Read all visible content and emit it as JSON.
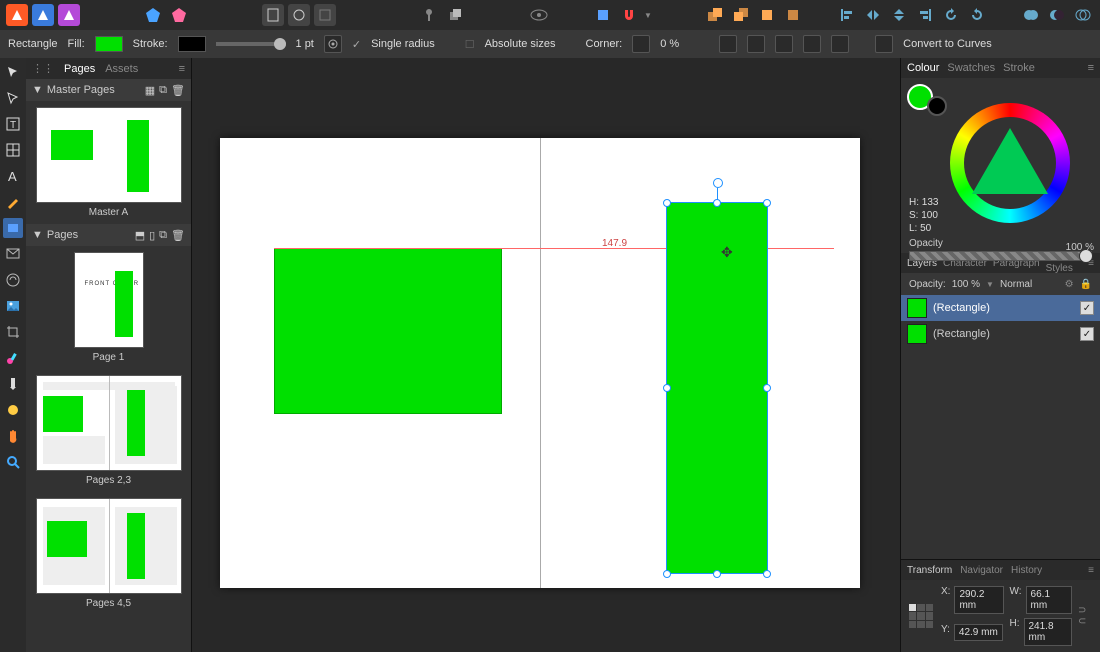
{
  "top_toolbar": {
    "app_icons": [
      "designer-app",
      "publisher-app",
      "photo-app"
    ],
    "groups": [
      [
        "persona-outline",
        "persona-pixel"
      ],
      [
        "doc-new",
        "shape-circle",
        "shape-square"
      ],
      [
        "pin",
        "layers-small"
      ],
      [
        "preview-mode"
      ],
      [
        "snap-toggle",
        "magnet"
      ],
      [
        "arrange-front",
        "arrange-back",
        "arrange-fwd",
        "arrange-bwd"
      ],
      [
        "align-left",
        "align-center",
        "align-right",
        "align-top",
        "align-mid",
        "align-bot"
      ],
      [
        "bool-add",
        "bool-sub",
        "bool-int"
      ]
    ]
  },
  "context_bar": {
    "shape": "Rectangle",
    "fill_label": "Fill:",
    "fill": "#00e000",
    "stroke_label": "Stroke:",
    "stroke": "#000000",
    "stroke_pt": "1 pt",
    "single_radius": "Single radius",
    "absolute_sizes": "Absolute sizes",
    "corner_label": "Corner:",
    "corner_pct": "0 %",
    "convert": "Convert to Curves"
  },
  "left_tools": [
    "move",
    "node",
    "text-frame",
    "table",
    "artistic-text",
    "pen",
    "rectangle",
    "envelope",
    "asset",
    "image-place",
    "crop",
    "brush",
    "color-picker",
    "fill",
    "hand",
    "zoom"
  ],
  "pages_panel": {
    "tabs": [
      "Pages",
      "Assets"
    ],
    "master_header": "Master Pages",
    "masters": [
      {
        "label": "Master A"
      }
    ],
    "pages_header": "Pages",
    "pages": [
      {
        "label": "Page 1",
        "cover_text": "FRONT COVER"
      },
      {
        "label": "Pages 2,3"
      },
      {
        "label": "Pages 4,5"
      }
    ]
  },
  "canvas": {
    "guide_value": "147.9"
  },
  "colour_panel": {
    "tabs": [
      "Colour",
      "Swatches",
      "Stroke"
    ],
    "hsl": {
      "H": "H: 133",
      "S": "S: 100",
      "L": "L: 50"
    },
    "opacity_label": "Opacity",
    "opacity_value": "100 %"
  },
  "layers_panel": {
    "tabs": [
      "Layers",
      "Character",
      "Paragraph",
      "Text Styles"
    ],
    "opacity_label": "Opacity:",
    "opacity_value": "100 %",
    "blend": "Normal",
    "rows": [
      {
        "name": "(Rectangle)",
        "selected": true,
        "visible": true
      },
      {
        "name": "(Rectangle)",
        "selected": false,
        "visible": true
      }
    ]
  },
  "transform_panel": {
    "tabs": [
      "Transform",
      "Navigator",
      "History"
    ],
    "X_label": "X:",
    "X": "290.2 mm",
    "Y_label": "Y:",
    "Y": "42.9 mm",
    "W_label": "W:",
    "W": "66.1 mm",
    "H_label": "H:",
    "H": "241.8 mm"
  }
}
